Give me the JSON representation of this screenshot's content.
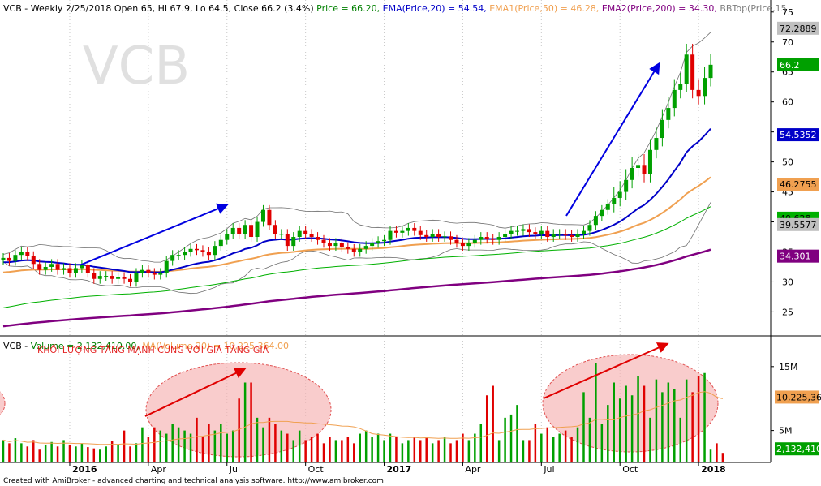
{
  "watermark": "VCB",
  "title": {
    "parts": [
      {
        "text": "VCB - Weekly 2/25/2018 Open 65, Hi 67.9, Lo 64.5, Close 66.2 (3.4%) ",
        "color": "#000000"
      },
      {
        "text": "Price = 66.20, ",
        "color": "#008000"
      },
      {
        "text": "EMA(Price,20) = 54.54, ",
        "color": "#0000c8"
      },
      {
        "text": "EMA1(Price,50) = 46.28, ",
        "color": "#f0a050"
      },
      {
        "text": "EMA2(Price,200) = 34.30, ",
        "color": "#800080"
      },
      {
        "text": "BBTop(Price,15",
        "color": "#808080"
      }
    ]
  },
  "volume_title": {
    "parts": [
      {
        "text": "VCB - ",
        "color": "#000000"
      },
      {
        "text": "Volume = 2,132,410.00, ",
        "color": "#008000"
      },
      {
        "text": "MA(Volume,20) = 10,225,364.00",
        "color": "#f0a050"
      }
    ]
  },
  "annotation_text": "KHỐI LƯỢNG TĂNG MẠNH CÙNG VỚI GIÁ TĂNG GIÁ",
  "footer": "Created with AmiBroker - advanced charting and technical analysis software. http://www.amibroker.com",
  "colors": {
    "up": "#00a000",
    "down": "#e00000",
    "ema20": "#0000c8",
    "ema50": "#f0a050",
    "ema200": "#800080",
    "ma60": "#00b000",
    "bb": "#808080",
    "arrow": "#0000e0",
    "vol_arrow": "#e00000",
    "ellipse_fill": "#f6b0b0",
    "ellipse_stroke": "#e05050"
  },
  "price_labels": [
    {
      "text": "72.2889",
      "value": 72.2889,
      "bg": "#c0c0c0",
      "fg": "#000000"
    },
    {
      "text": "66.2",
      "value": 66.2,
      "bg": "#00a000",
      "fg": "#ffffff"
    },
    {
      "text": "54.5352",
      "value": 54.5352,
      "bg": "#0000c8",
      "fg": "#ffffff"
    },
    {
      "text": "46.2755",
      "value": 46.2755,
      "bg": "#f0a050",
      "fg": "#000000"
    },
    {
      "text": "40.628",
      "value": 40.628,
      "bg": "#00b000",
      "fg": "#000000"
    },
    {
      "text": "39.5577",
      "value": 39.5577,
      "bg": "#c0c0c0",
      "fg": "#000000"
    },
    {
      "text": "34.301",
      "value": 34.301,
      "bg": "#800080",
      "fg": "#ffffff"
    }
  ],
  "volume_labels": [
    {
      "text": "10,225,36",
      "value": 10.225,
      "bg": "#f0a050",
      "fg": "#000000"
    },
    {
      "text": "2,132,410",
      "value": 2.13,
      "bg": "#00a000",
      "fg": "#ffffff"
    }
  ],
  "chart_data": [
    {
      "type": "candlestick",
      "title": "VCB - Weekly",
      "ylim": [
        21,
        77
      ],
      "yticks": [
        25,
        30,
        35,
        40,
        45,
        50,
        55,
        60,
        65,
        70,
        75
      ],
      "x_tick_labels": [
        {
          "text": "2016",
          "week": 11,
          "bold": true
        },
        {
          "text": "Apr",
          "week": 24
        },
        {
          "text": "Jul",
          "week": 37
        },
        {
          "text": "Oct",
          "week": 50
        },
        {
          "text": "2017",
          "week": 63,
          "bold": true
        },
        {
          "text": "Apr",
          "week": 76
        },
        {
          "text": "Jul",
          "week": 89
        },
        {
          "text": "Oct",
          "week": 102
        },
        {
          "text": "2018",
          "week": 115,
          "bold": true
        }
      ],
      "close": [
        34,
        33.5,
        34.5,
        35,
        34.3,
        33,
        32,
        32.5,
        33,
        32,
        32.3,
        31.5,
        32.3,
        32.8,
        31.5,
        30.5,
        31,
        31,
        30.5,
        30.8,
        30.5,
        30,
        31.5,
        32,
        31.5,
        31.2,
        31.5,
        33.5,
        34.5,
        34.5,
        35,
        35.5,
        35.3,
        35,
        34.5,
        36,
        37,
        38,
        39,
        38,
        39.5,
        37.5,
        40,
        42,
        39.5,
        38,
        38,
        36,
        37.5,
        38.5,
        38,
        37.5,
        37,
        36.5,
        36,
        36.5,
        35.8,
        35.5,
        35,
        35.5,
        36,
        36.5,
        36.8,
        37,
        38.5,
        38.2,
        38.5,
        39,
        38.5,
        37.8,
        37.5,
        38,
        37.5,
        37.6,
        37,
        36.5,
        36,
        36.5,
        37,
        37.5,
        37.2,
        37,
        37.5,
        38,
        38.5,
        38.5,
        38.8,
        38.3,
        38,
        38.5,
        37.5,
        38,
        38,
        37.8,
        37.5,
        38,
        38.5,
        39.5,
        41,
        42,
        43,
        44,
        45,
        47,
        49,
        49.5,
        48,
        52,
        54,
        57,
        59,
        62,
        63,
        67.9,
        62,
        61,
        64,
        66.2
      ],
      "volume_millions": [
        3.5,
        3,
        3.8,
        3,
        2.5,
        3.5,
        2,
        2.8,
        3.2,
        2.5,
        3.5,
        2.8,
        2.5,
        3,
        2.4,
        2.2,
        2,
        2.5,
        3.3,
        2.8,
        5,
        2.5,
        3,
        5.5,
        4,
        5.5,
        5,
        4.5,
        6,
        5.5,
        5,
        4.5,
        7,
        4,
        6,
        5,
        6,
        4.5,
        5,
        10,
        12.5,
        12.5,
        7,
        5.5,
        7,
        6,
        5,
        4.5,
        3.5,
        5,
        3.5,
        4,
        4.5,
        3,
        4,
        3.5,
        3.5,
        4,
        3,
        4.5,
        5,
        4,
        4.5,
        3.5,
        4.5,
        4,
        3,
        3.5,
        4,
        3.5,
        4,
        3,
        3.5,
        4,
        3,
        3.5,
        4.5,
        3.5,
        4.5,
        6,
        10.5,
        12,
        3.5,
        7,
        7.5,
        9,
        3.5,
        3.5,
        6,
        4.5,
        5.5,
        4,
        4.5,
        5,
        4,
        5.5,
        11,
        7,
        15.5,
        6,
        9,
        12.5,
        10,
        12,
        10.5,
        13.5,
        12,
        7,
        13,
        11,
        12.5,
        11.5,
        7,
        13,
        11,
        13.5,
        14,
        2,
        3,
        1.5
      ],
      "ema20_label": "EMA(Price,20) = 54.54",
      "ema50_label": "EMA1(Price,50) = 46.28",
      "ema200_label": "EMA2(Price,200) = 34.30"
    }
  ]
}
